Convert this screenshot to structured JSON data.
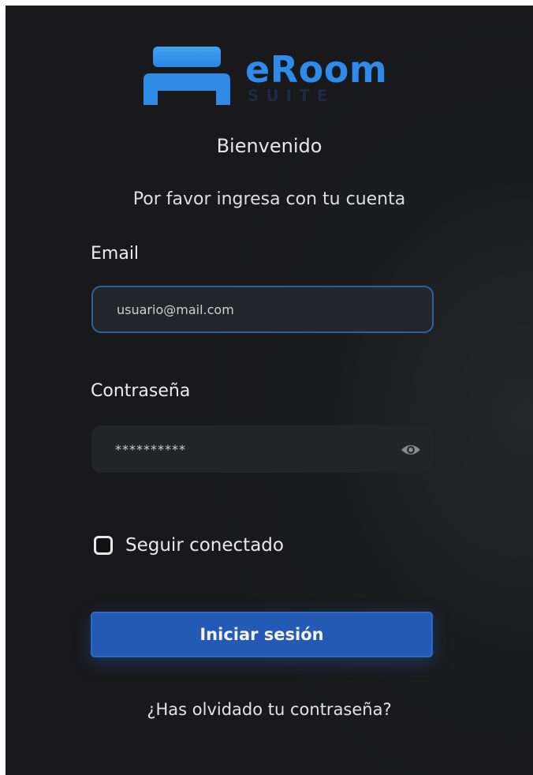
{
  "brand": {
    "name": "eRoom",
    "tagline": "SUITE",
    "logo_icon": "bed-icon",
    "accent_color": "#2e8bea"
  },
  "welcome_text": "Bienvenido",
  "prompt_text": "Por favor ingresa con tu cuenta",
  "email": {
    "label": "Email",
    "value": "usuario@mail.com"
  },
  "password": {
    "label": "Contraseña",
    "value": "**********",
    "toggle_icon": "eye-icon"
  },
  "remember_me": {
    "label": "Seguir conectado",
    "checked": false
  },
  "login_button_label": "Iniciar sesión",
  "forgot_password_link": "¿Has olvidado tu contraseña?",
  "colors": {
    "background": "#1b1c1e",
    "button": "#2459b4",
    "email_border": "#2c5ea3"
  }
}
